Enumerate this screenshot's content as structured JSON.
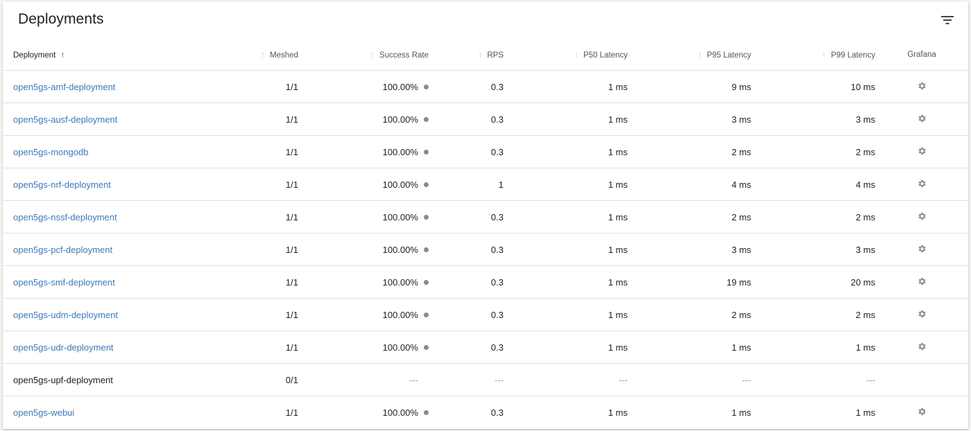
{
  "header": {
    "title": "Deployments",
    "filter_icon": "filter-list-icon"
  },
  "columns": [
    "Deployment",
    "Meshed",
    "Success Rate",
    "RPS",
    "P50 Latency",
    "P95 Latency",
    "P99 Latency",
    "Grafana"
  ],
  "sort_icon": "arrow-up-icon",
  "rows": [
    {
      "name": "open5gs-amf-deployment",
      "meshed": "1/1",
      "success": "100.00%",
      "rps": "0.3",
      "p50": "1 ms",
      "p95": "9 ms",
      "p99": "10 ms",
      "grafana": true
    },
    {
      "name": "open5gs-ausf-deployment",
      "meshed": "1/1",
      "success": "100.00%",
      "rps": "0.3",
      "p50": "1 ms",
      "p95": "3 ms",
      "p99": "3 ms",
      "grafana": true
    },
    {
      "name": "open5gs-mongodb",
      "meshed": "1/1",
      "success": "100.00%",
      "rps": "0.3",
      "p50": "1 ms",
      "p95": "2 ms",
      "p99": "2 ms",
      "grafana": true
    },
    {
      "name": "open5gs-nrf-deployment",
      "meshed": "1/1",
      "success": "100.00%",
      "rps": "1",
      "p50": "1 ms",
      "p95": "4 ms",
      "p99": "4 ms",
      "grafana": true
    },
    {
      "name": "open5gs-nssf-deployment",
      "meshed": "1/1",
      "success": "100.00%",
      "rps": "0.3",
      "p50": "1 ms",
      "p95": "2 ms",
      "p99": "2 ms",
      "grafana": true
    },
    {
      "name": "open5gs-pcf-deployment",
      "meshed": "1/1",
      "success": "100.00%",
      "rps": "0.3",
      "p50": "1 ms",
      "p95": "3 ms",
      "p99": "3 ms",
      "grafana": true
    },
    {
      "name": "open5gs-smf-deployment",
      "meshed": "1/1",
      "success": "100.00%",
      "rps": "0.3",
      "p50": "1 ms",
      "p95": "19 ms",
      "p99": "20 ms",
      "grafana": true
    },
    {
      "name": "open5gs-udm-deployment",
      "meshed": "1/1",
      "success": "100.00%",
      "rps": "0.3",
      "p50": "1 ms",
      "p95": "2 ms",
      "p99": "2 ms",
      "grafana": true
    },
    {
      "name": "open5gs-udr-deployment",
      "meshed": "1/1",
      "success": "100.00%",
      "rps": "0.3",
      "p50": "1 ms",
      "p95": "1 ms",
      "p99": "1 ms",
      "grafana": true
    },
    {
      "name": "open5gs-upf-deployment",
      "meshed": "0/1",
      "success": "---",
      "rps": "---",
      "p50": "---",
      "p95": "---",
      "p99": "---",
      "grafana": false
    },
    {
      "name": "open5gs-webui",
      "meshed": "1/1",
      "success": "100.00%",
      "rps": "0.3",
      "p50": "1 ms",
      "p95": "1 ms",
      "p99": "1 ms",
      "grafana": true
    }
  ],
  "colors": {
    "link": "#3a7ab8",
    "status_dot": "#8a8a8a",
    "divider": "#e0e0e0"
  },
  "grafana_icon": "grafana-icon"
}
